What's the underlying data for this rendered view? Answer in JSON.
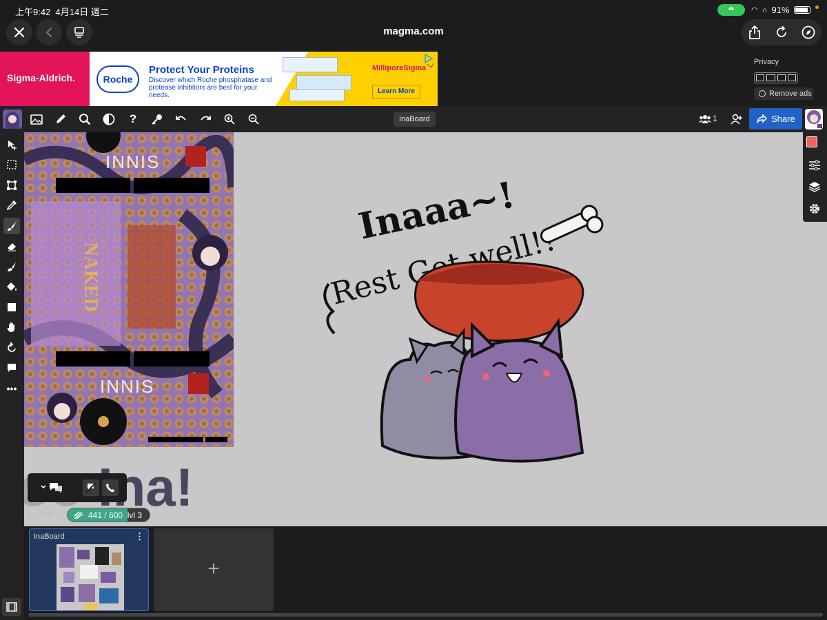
{
  "status_bar": {
    "time": "上午9:42",
    "date": "4月14日 週二",
    "battery": "91%"
  },
  "browser": {
    "title": "magma.com"
  },
  "ad": {
    "brand_left": "Sigma-Aldrich.",
    "roche": "Roche",
    "headline": "Protect Your Proteins",
    "body": "Discover which Roche phosphatase and protease inhibitors are best for your needs.",
    "brand_right": "MilliporeSigma",
    "cta": "Learn More",
    "privacy": "Privacy",
    "remove_ads": "Remove ads"
  },
  "toolbar": {
    "board_name": "InaBoard",
    "user_count": "1",
    "share_label": "Share"
  },
  "canvas": {
    "big_text": "Ina!",
    "poster_word_top": "INNIS",
    "poster_word_bottom": "INNIS",
    "drawing_text_1": "Inaaa~!",
    "drawing_text_2": "Rest Get well!!"
  },
  "status": {
    "zoom": "164%",
    "progress_text": "441 / 600",
    "progress_fraction": 0.735,
    "level": "lvl 3"
  },
  "boards": {
    "items": [
      {
        "name": "InaBoard"
      }
    ],
    "add_label": "+"
  },
  "colors": {
    "accent": "#2261c8",
    "progress": "#3ba785",
    "primary_swatch": "#f06262",
    "secondary_swatch": "#f6c33b"
  }
}
